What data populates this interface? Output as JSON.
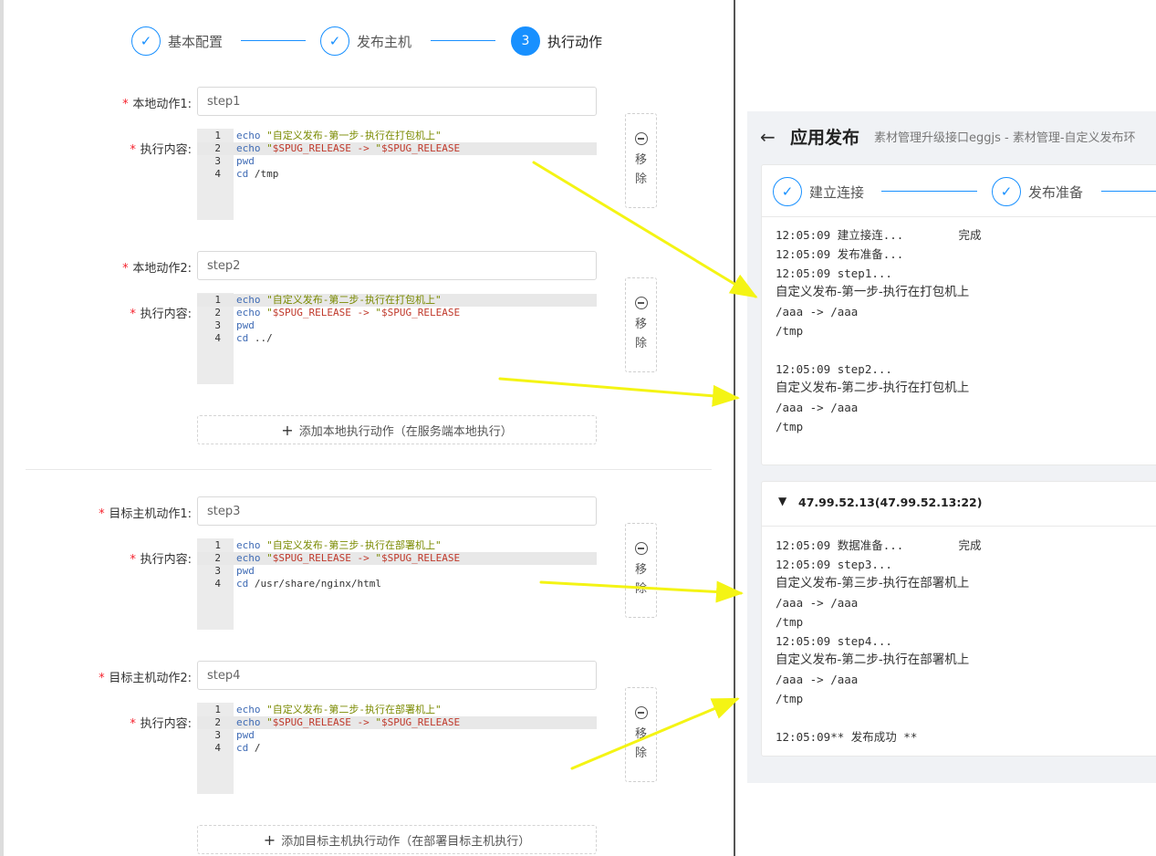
{
  "steps": [
    {
      "label": "基本配置",
      "state": "done"
    },
    {
      "label": "发布主机",
      "state": "done"
    },
    {
      "label": "执行动作",
      "state": "active",
      "number": "3"
    }
  ],
  "form": {
    "local_action_1": {
      "label": "本地动作1:",
      "value": "step1",
      "content_label": "执行内容:",
      "lines": [
        [
          "echo ",
          "\"自定义发布-第一步-执行在打包机上\""
        ],
        [
          "echo ",
          "\"$SPUG_RELEASE -> \"$SPUG_RELEASE"
        ],
        [
          "pwd",
          ""
        ],
        [
          "cd /tmp",
          ""
        ]
      ]
    },
    "local_action_2": {
      "label": "本地动作2:",
      "value": "step2",
      "content_label": "执行内容:",
      "lines": [
        [
          "echo ",
          "\"自定义发布-第二步-执行在打包机上\""
        ],
        [
          "echo ",
          "\"$SPUG_RELEASE -> \"$SPUG_RELEASE"
        ],
        [
          "pwd",
          ""
        ],
        [
          "cd ../",
          ""
        ]
      ]
    },
    "add_local": "添加本地执行动作（在服务端本地执行）",
    "target_action_1": {
      "label": "目标主机动作1:",
      "value": "step3",
      "content_label": "执行内容:",
      "lines": [
        [
          "echo ",
          "\"自定义发布-第三步-执行在部署机上\""
        ],
        [
          "echo ",
          "\"$SPUG_RELEASE -> \"$SPUG_RELEASE"
        ],
        [
          "pwd",
          ""
        ],
        [
          "cd /usr/share/nginx/html",
          ""
        ]
      ]
    },
    "target_action_2": {
      "label": "目标主机动作2:",
      "value": "step4",
      "content_label": "执行内容:",
      "lines": [
        [
          "echo ",
          "\"自定义发布-第二步-执行在部署机上\""
        ],
        [
          "echo ",
          "\"$SPUG_RELEASE -> \"$SPUG_RELEASE"
        ],
        [
          "pwd",
          ""
        ],
        [
          "cd /",
          ""
        ]
      ]
    },
    "add_target": "添加目标主机执行动作（在部署目标主机执行）",
    "remove_label": "移除"
  },
  "release": {
    "title": "应用发布",
    "subtitle": "素材管理升级接口eggjs - 素材管理-自定义发布环",
    "steps": [
      "建立连接",
      "发布准备"
    ],
    "local_log": [
      "12:05:09 建立接连...        完成",
      "12:05:09 发布准备...",
      "12:05:09 step1...",
      "自定义发布-第一步-执行在打包机上",
      "/aaa -> /aaa",
      "/tmp",
      "",
      "12:05:09 step2...",
      "自定义发布-第二步-执行在打包机上",
      "/aaa -> /aaa",
      "/tmp"
    ],
    "host": "47.99.52.13(47.99.52.13:22)",
    "host_log": [
      "12:05:09 数据准备...        完成",
      "12:05:09 step3...",
      "自定义发布-第三步-执行在部署机上",
      "/aaa -> /aaa",
      "/tmp",
      "12:05:09 step4...",
      "自定义发布-第二步-执行在部署机上",
      "/aaa -> /aaa",
      "/tmp",
      "",
      "12:05:09** 发布成功 **"
    ]
  },
  "colors": {
    "primary": "#1890ff",
    "required": "#f5222d",
    "arrow": "#f4f414"
  }
}
